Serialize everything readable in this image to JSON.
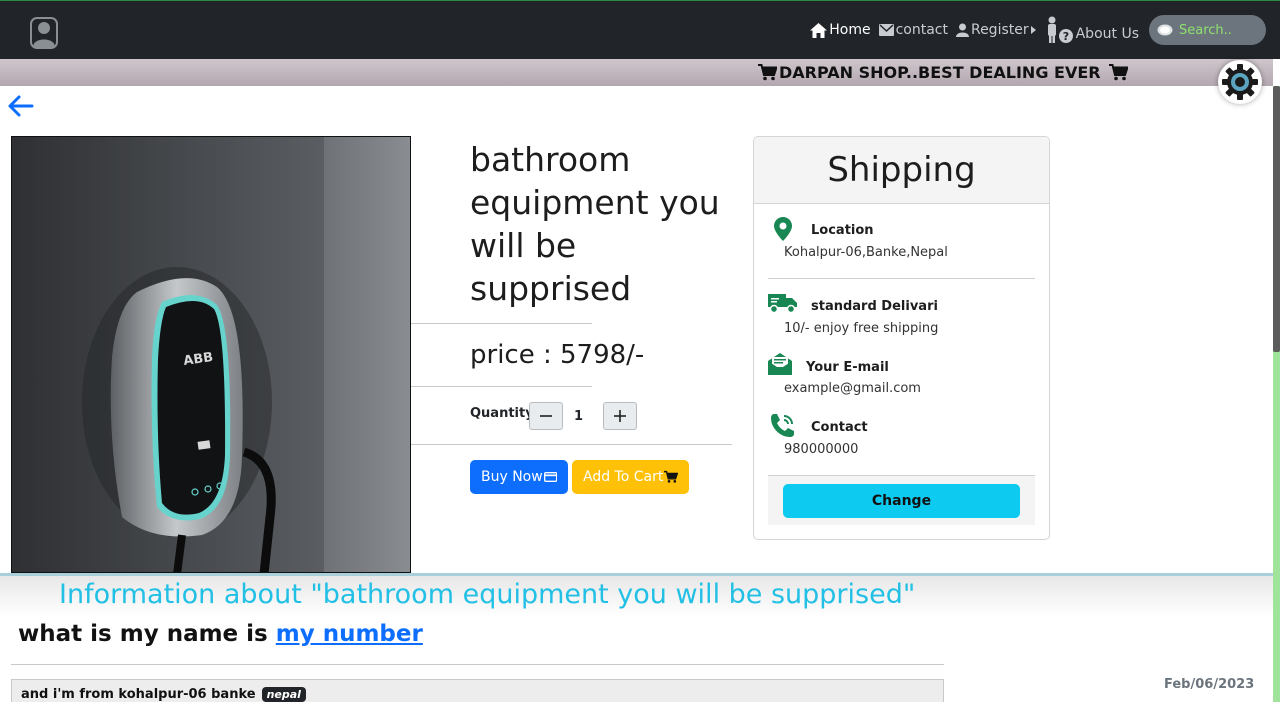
{
  "navbar": {
    "links": [
      {
        "label": "Home",
        "icon": "home-icon"
      },
      {
        "label": "contact",
        "icon": "envelope-icon"
      },
      {
        "label": "Register",
        "icon": "person-icon"
      },
      {
        "label": "About Us",
        "icon": "person-question-icon"
      }
    ],
    "search_placeholder": "Search.."
  },
  "banner": {
    "text": "DARPAN SHOP..BEST DEALING EVER"
  },
  "product": {
    "title": "bathroom equipment you will be supprised",
    "price": "price : 5798/-",
    "quantity_label": "Quantity",
    "quantity_value": "1",
    "buy_label": "Buy Now",
    "cart_label": "Add To Cart",
    "image_logo": "ABB"
  },
  "shipping": {
    "title": "Shipping",
    "location_label": "Location",
    "location_value": "Kohalpur-06,Banke,Nepal",
    "delivery_label": "standard Delivari",
    "delivery_value": "10/- enjoy free shipping",
    "email_label": "Your E-mail",
    "email_value": "example@gmail.com",
    "contact_label": "Contact",
    "contact_value": "980000000",
    "change_label": "Change"
  },
  "info": {
    "title": "Information about \"bathroom equipment you will be supprised\"",
    "subtitle_text": "what is my name is ",
    "subtitle_link": "my number",
    "box_text": "and i'm from kohalpur-06 banke",
    "badge": "nepal",
    "date": "Feb/06/2023"
  },
  "colors": {
    "navbar": "#212529",
    "primary": "#0d6efd",
    "warning": "#ffc107",
    "info": "#0dcaf0",
    "icon_green": "#198754"
  }
}
